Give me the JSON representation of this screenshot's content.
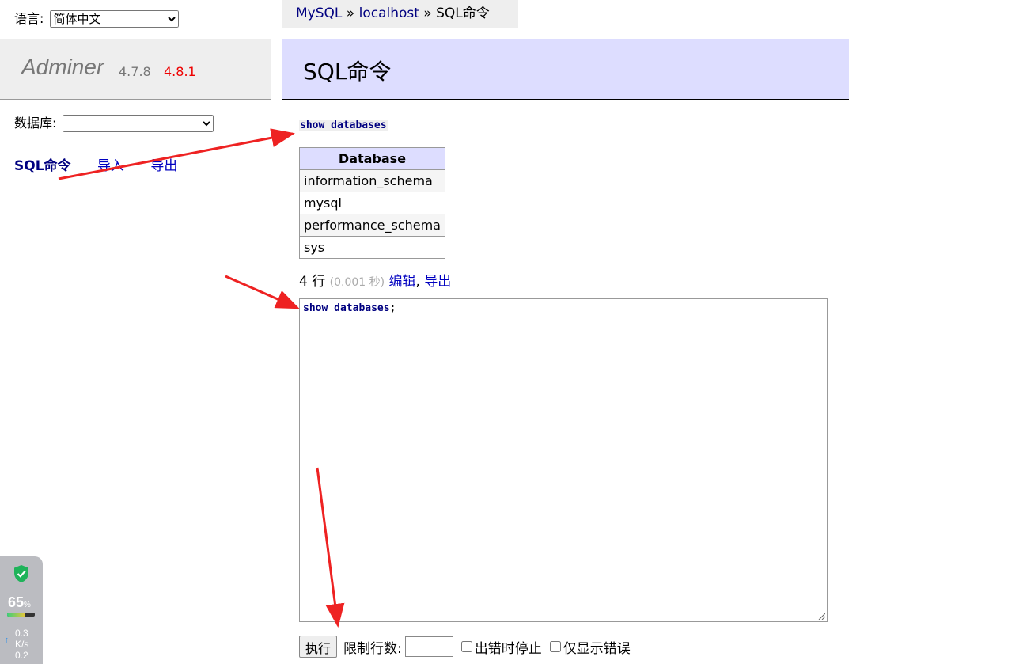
{
  "language": {
    "label": "语言:",
    "selected": "简体中文"
  },
  "brand": {
    "name": "Adminer",
    "version": "4.7.8",
    "new_version": "4.8.1"
  },
  "database": {
    "label": "数据库:",
    "selected": ""
  },
  "menu": {
    "sql": "SQL命令",
    "import": "导入",
    "export": "导出"
  },
  "breadcrumb": {
    "driver": "MySQL",
    "sep1": " » ",
    "server": "localhost",
    "sep2": " » ",
    "current": "SQL命令"
  },
  "page_title": "SQL命令",
  "query": "show databases",
  "result": {
    "header": "Database",
    "rows": [
      "information_schema",
      "mysql",
      "performance_schema",
      "sys"
    ]
  },
  "stats": {
    "rows": "4 行",
    "time": "(0.001 秒)",
    "edit": "编辑",
    "comma": ",",
    "export": "导出"
  },
  "editor": {
    "code": "show databases",
    "semicolon": ";"
  },
  "form": {
    "execute": "执行",
    "limit_label": "限制行数:",
    "limit_value": "",
    "stop_on_error": "出错时停止",
    "errors_only": "仅显示错误"
  },
  "widget": {
    "percent": "65",
    "percent_unit": "%",
    "percent_value": 65,
    "speed_up": "0.3",
    "speed_unit": "K/s",
    "speed_down": "0.2"
  },
  "colors": {
    "accent_heading": "#ddddff",
    "link": "#0000c0",
    "new_version": "#ee0000",
    "annotation": "#ee2222"
  }
}
